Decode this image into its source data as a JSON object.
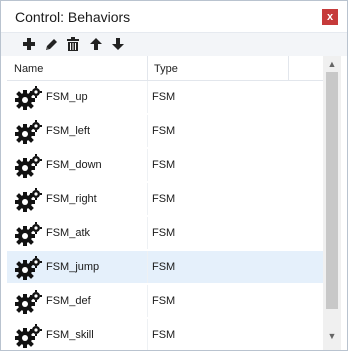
{
  "window": {
    "title": "Control: Behaviors",
    "close_label": "x"
  },
  "toolbar": {
    "buttons": [
      {
        "name": "add",
        "icon": "plus-icon"
      },
      {
        "name": "edit",
        "icon": "pencil-icon"
      },
      {
        "name": "delete",
        "icon": "trash-icon"
      },
      {
        "name": "move_up",
        "icon": "arrow-up-icon"
      },
      {
        "name": "move_down",
        "icon": "arrow-down-icon"
      }
    ]
  },
  "list": {
    "columns": [
      "Name",
      "Type"
    ],
    "rows": [
      {
        "name": "FSM_up",
        "type": "FSM",
        "icon": "gear-icon",
        "selected": false
      },
      {
        "name": "FSM_left",
        "type": "FSM",
        "icon": "gear-icon",
        "selected": false
      },
      {
        "name": "FSM_down",
        "type": "FSM",
        "icon": "gear-icon",
        "selected": false
      },
      {
        "name": "FSM_right",
        "type": "FSM",
        "icon": "gear-icon",
        "selected": false
      },
      {
        "name": "FSM_atk",
        "type": "FSM",
        "icon": "gear-icon",
        "selected": false
      },
      {
        "name": "FSM_jump",
        "type": "FSM",
        "icon": "gear-icon",
        "selected": true
      },
      {
        "name": "FSM_def",
        "type": "FSM",
        "icon": "gear-icon",
        "selected": false
      },
      {
        "name": "FSM_skill",
        "type": "FSM",
        "icon": "gear-icon",
        "selected": false
      }
    ]
  },
  "colors": {
    "selected_row": "#e5f0fb",
    "close_button": "#c63a3a"
  }
}
